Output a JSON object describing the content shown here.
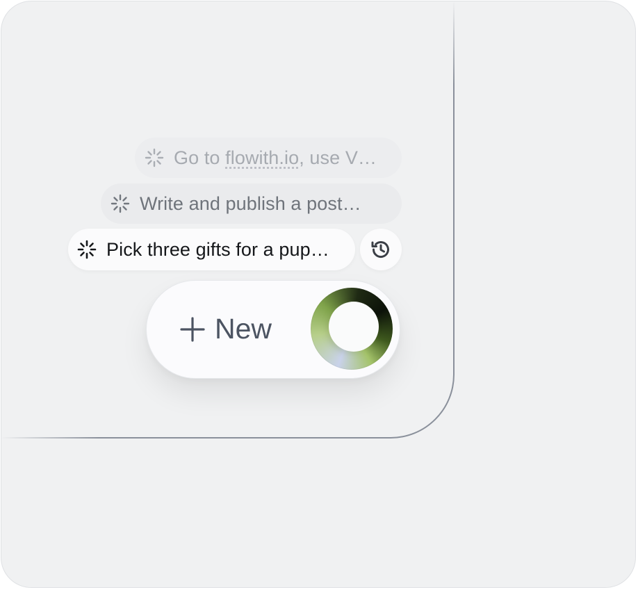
{
  "tasks": [
    {
      "prefix": "Go to ",
      "link": "flowith.io",
      "suffix": ", use V…",
      "status_icon": "spinner-icon"
    },
    {
      "label": "Write and publish a post…",
      "status_icon": "spinner-icon"
    },
    {
      "label": "Pick three gifts for a pup…",
      "status_icon": "spinner-icon"
    }
  ],
  "history_icon": "history-icon",
  "new_button": {
    "icon": "plus-icon",
    "label": "New"
  },
  "colors": {
    "background": "#f0f1f2",
    "orb_dark": "#0c1209",
    "orb_green": "#b7cf8a",
    "orb_lavender": "#c9d2ea"
  }
}
